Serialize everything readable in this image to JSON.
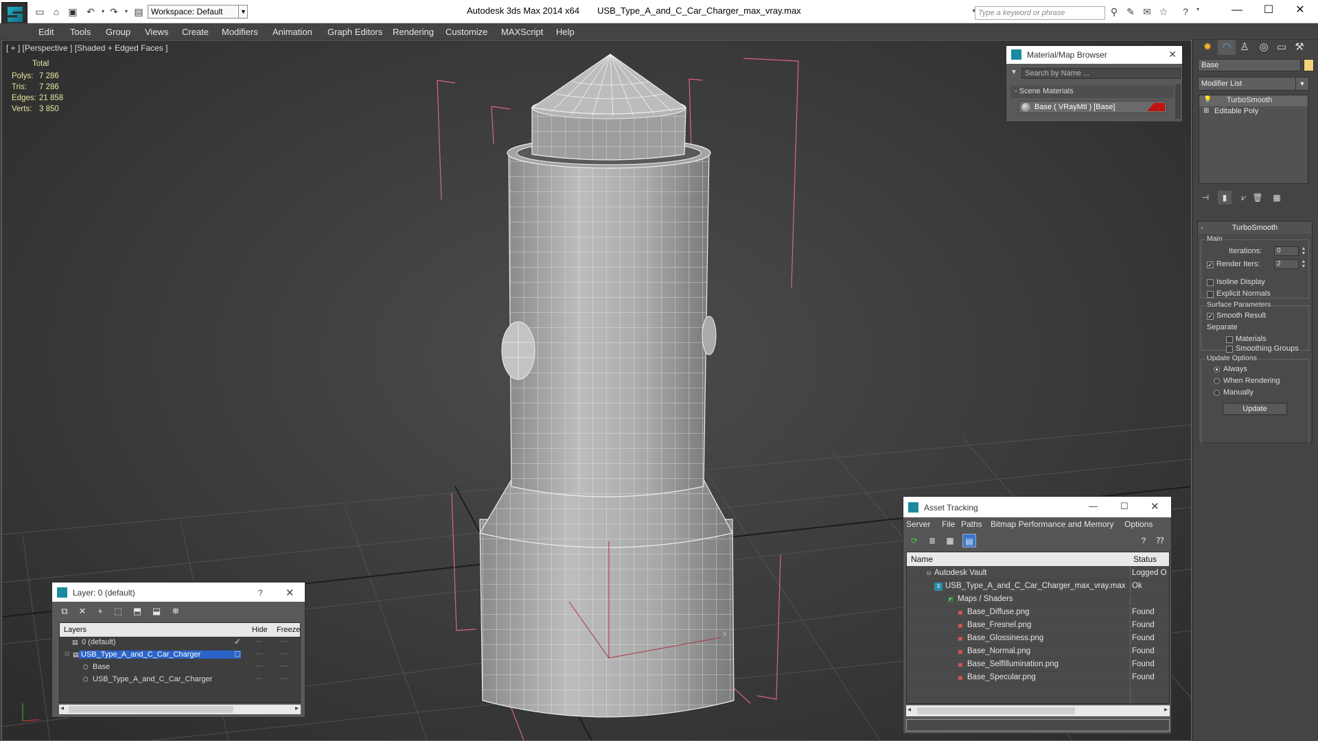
{
  "titlebar": {
    "workspace": "Workspace: Default",
    "app_name": "Autodesk 3ds Max  2014 x64",
    "file_name": "USB_Type_A_and_C_Car_Charger_max_vray.max",
    "search_placeholder": "Type a keyword or phrase"
  },
  "menu": [
    "Edit",
    "Tools",
    "Group",
    "Views",
    "Create",
    "Modifiers",
    "Animation",
    "Graph Editors",
    "Rendering",
    "Customize",
    "MAXScript",
    "Help"
  ],
  "viewport": {
    "label": "[ + ] [Perspective ] [Shaded + Edged Faces ]",
    "stats_header": "Total",
    "stats": [
      {
        "label": "Polys:",
        "value": "7 286"
      },
      {
        "label": "Tris:",
        "value": "7 286"
      },
      {
        "label": "Edges:",
        "value": "21 858"
      },
      {
        "label": "Verts:",
        "value": "3 850"
      }
    ],
    "gizmo": {
      "x": "x",
      "y": "y",
      "z": "z"
    }
  },
  "material_browser": {
    "title": "Material/Map Browser",
    "search_placeholder": "Search by Name ...",
    "section": "Scene Materials",
    "item": "Base  ( VRayMtl )  [Base]",
    "swatch_color": "#c31212"
  },
  "command_panel": {
    "object_name": "Base",
    "object_color": "#f2d27b",
    "modifier_list": "Modifier List",
    "stack": [
      "TurboSmooth",
      "Editable Poly"
    ],
    "turbosmooth": {
      "title": "TurboSmooth",
      "main": "Main",
      "iterations_label": "Iterations:",
      "iterations": "0",
      "render_iters_label": "Render Iters:",
      "render_iters": "2",
      "isoline": "Isoline Display",
      "explicit": "Explicit Normals",
      "surface": "Surface Parameters",
      "smooth": "Smooth Result",
      "separate": "Separate",
      "materials": "Materials",
      "smoothing_groups": "Smoothing Groups",
      "update_options": "Update Options",
      "always": "Always",
      "when_rendering": "When Rendering",
      "manually": "Manually",
      "update": "Update"
    }
  },
  "layer_panel": {
    "title": "Layer: 0 (default)",
    "help": "?",
    "columns": {
      "layers": "Layers",
      "hide": "Hide",
      "freeze": "Freeze"
    },
    "rows": [
      {
        "name": "0 (default)"
      },
      {
        "name": "USB_Type_A_and_C_Car_Charger"
      },
      {
        "name": "Base"
      },
      {
        "name": "USB_Type_A_and_C_Car_Charger"
      }
    ]
  },
  "asset_panel": {
    "title": "Asset Tracking",
    "menu": [
      "Server",
      "File",
      "Paths",
      "Bitmap Performance and Memory",
      "Options"
    ],
    "columns": {
      "name": "Name",
      "status": "Status"
    },
    "rows": [
      {
        "name": "Autodesk Vault",
        "status": "Logged O"
      },
      {
        "name": "USB_Type_A_and_C_Car_Charger_max_vray.max",
        "status": "Ok"
      },
      {
        "name": "Maps / Shaders",
        "status": ""
      },
      {
        "name": "Base_Diffuse.png",
        "status": "Found"
      },
      {
        "name": "Base_Fresnel.png",
        "status": "Found"
      },
      {
        "name": "Base_Glossiness.png",
        "status": "Found"
      },
      {
        "name": "Base_Normal.png",
        "status": "Found"
      },
      {
        "name": "Base_SelfIllumination.png",
        "status": "Found"
      },
      {
        "name": "Base_Specular.png",
        "status": "Found"
      }
    ]
  }
}
